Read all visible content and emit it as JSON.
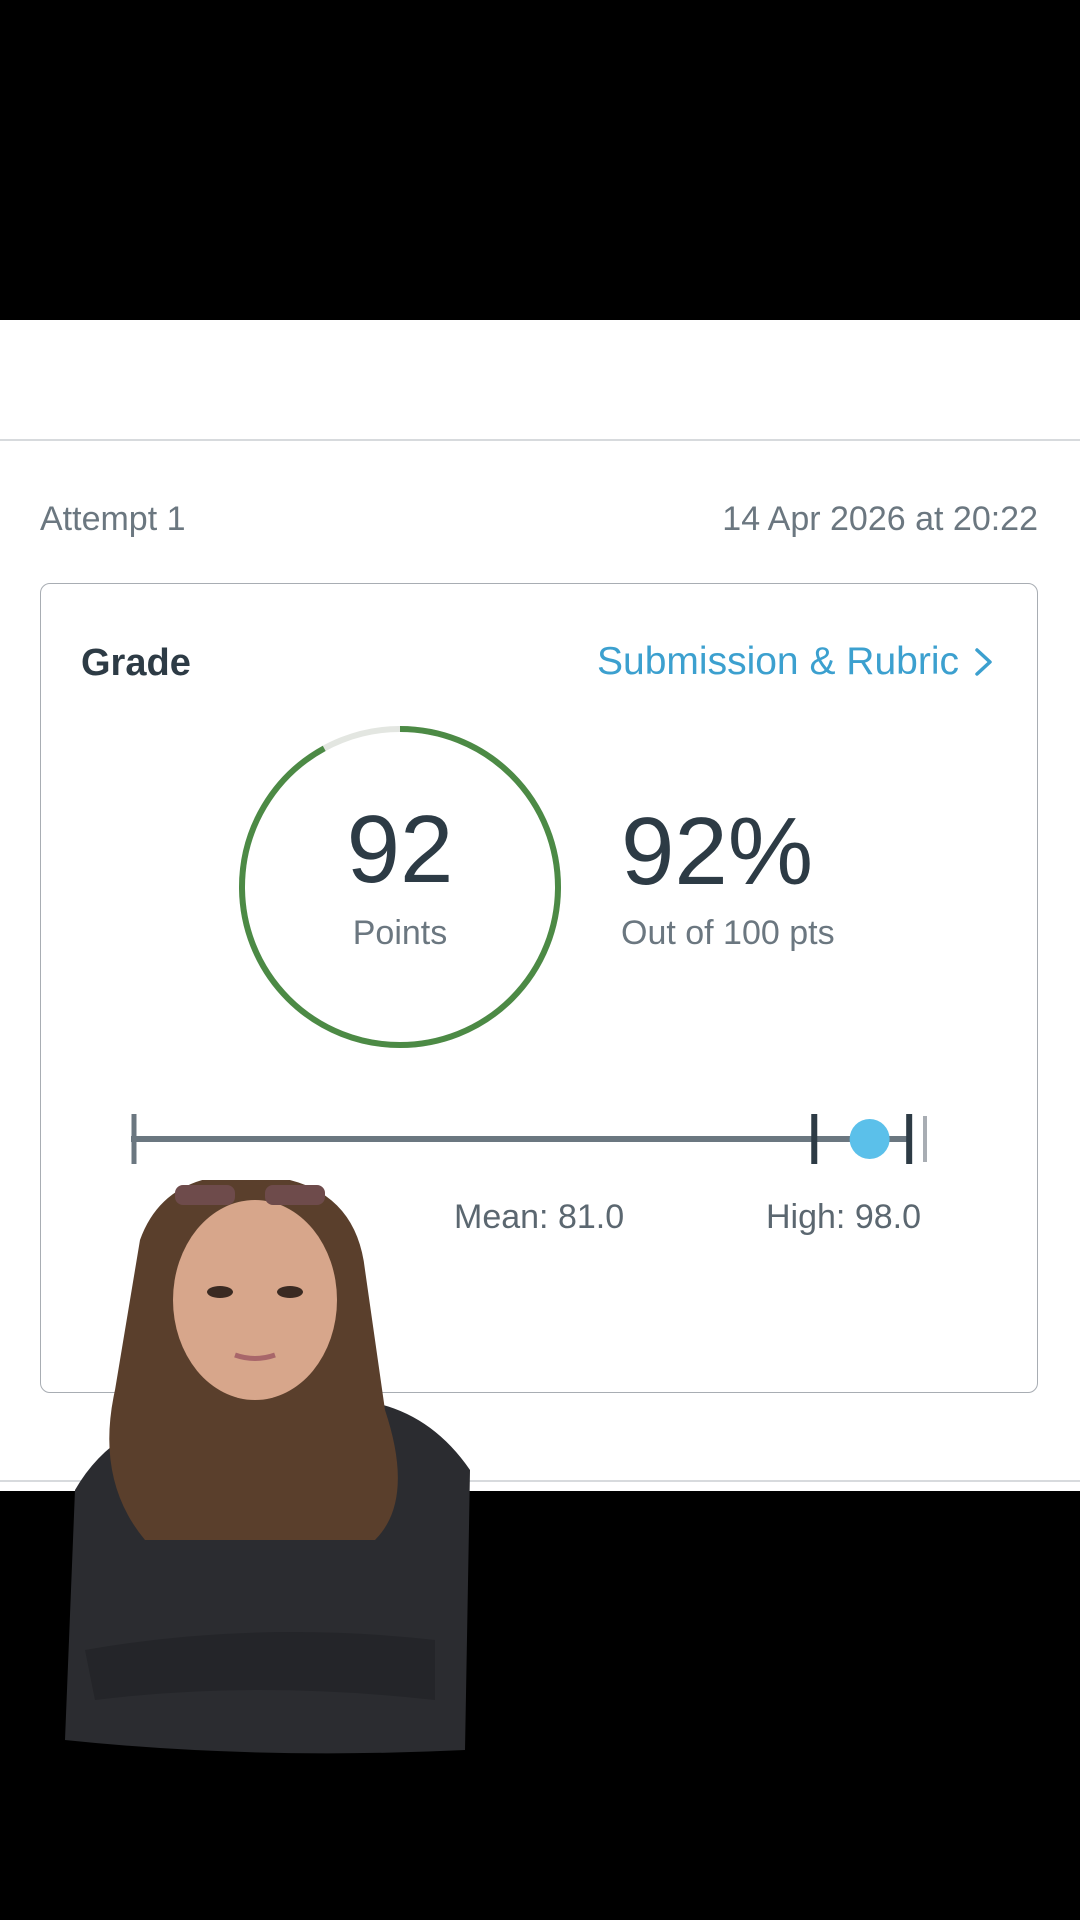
{
  "attempt": {
    "label": "Attempt 1",
    "date": "14 Apr 2026 at 20:22"
  },
  "grade_card": {
    "title": "Grade",
    "link_label": "Submission & Rubric",
    "points": "92",
    "points_label": "Points",
    "percent": "92%",
    "out_of": "Out of 100 pts",
    "score_fraction": 0.92
  },
  "stats": {
    "mean_label": "Mean: 81.0",
    "high_label": "High: 98.0",
    "mean": 81.0,
    "high": 98.0,
    "student_score": 92,
    "max": 100
  },
  "colors": {
    "ring_progress": "#4c8a45",
    "ring_track": "#e3e6e1",
    "link": "#3ca0cf",
    "score_marker": "#5bc0ea",
    "bar": "#6b7780"
  }
}
